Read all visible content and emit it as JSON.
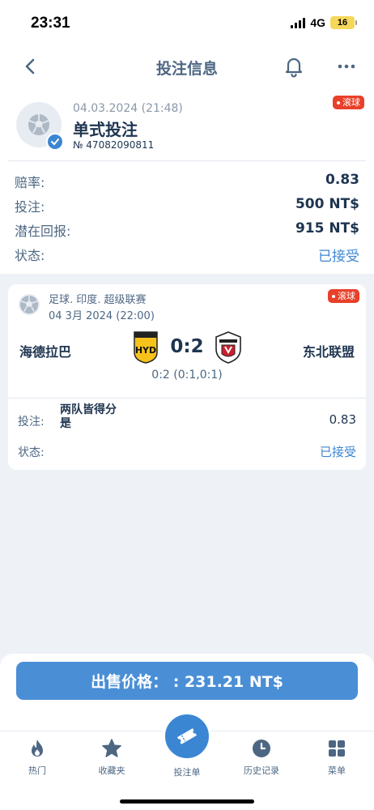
{
  "status_bar": {
    "time": "23:31",
    "network": "4G",
    "battery": "16"
  },
  "nav": {
    "title": "投注信息",
    "back_icon": "chevron-left-icon",
    "bell_icon": "bell-icon",
    "more_icon": "more-dots-icon"
  },
  "summary": {
    "datetime": "04.03.2024 (21:48)",
    "bet_type": "单式投注",
    "bet_id": "№ 47082090811",
    "live_badge": "滚球",
    "rows": [
      {
        "label": "赔率:",
        "value": "0.83"
      },
      {
        "label": "投注:",
        "value": "500 NT$"
      },
      {
        "label": "潜在回报:",
        "value": "915 NT$"
      },
      {
        "label": "状态:",
        "value": "已接受"
      }
    ]
  },
  "match": {
    "league": "足球. 印度. 超级联赛",
    "date": "04 3月 2024 (22:00)",
    "live_badge": "滚球",
    "home_team": "海德拉巴",
    "away_team": "东北联盟",
    "home_logo_text": "HYD",
    "score": "0:2",
    "score_detail": "0:2 (0:1,0:1)",
    "bet_label": "投注:",
    "bet_market_line1": "两队皆得分",
    "bet_market_line2": "是",
    "bet_odds": "0.83",
    "status_label": "状态:",
    "status_value": "已接受"
  },
  "sell": {
    "label": "出售价格： : 231.21 NT$"
  },
  "tabbar": {
    "items": [
      {
        "label": "热门",
        "icon": "fire-icon"
      },
      {
        "label": "收藏夹",
        "icon": "star-icon"
      },
      {
        "label": "投注单",
        "icon": "ticket-icon"
      },
      {
        "label": "历史记录",
        "icon": "clock-icon"
      },
      {
        "label": "菜单",
        "icon": "grid-icon"
      }
    ]
  },
  "colors": {
    "accent": "#3b86d3",
    "live": "#e8402a",
    "text": "#1f3550",
    "muted": "#4d6783"
  }
}
